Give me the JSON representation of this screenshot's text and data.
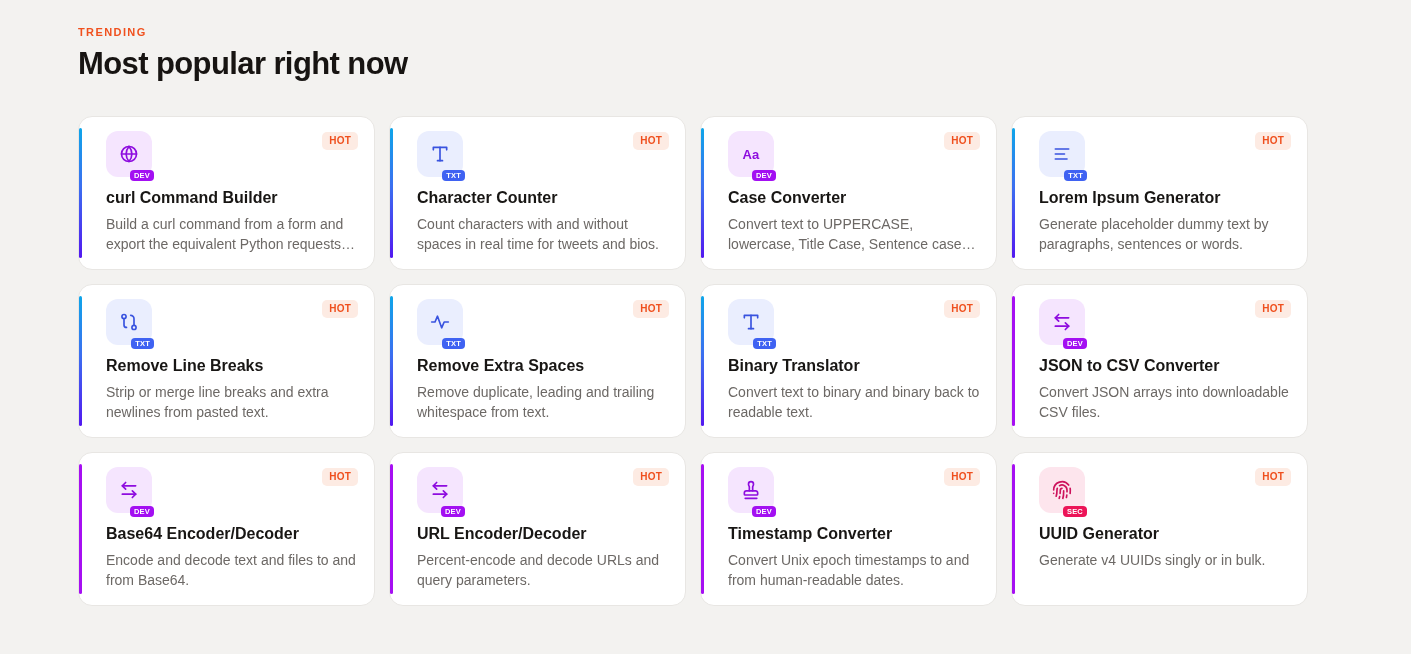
{
  "section": {
    "eyebrow": "TRENDING",
    "title": "Most popular right now"
  },
  "cards": [
    {
      "kind": "globe",
      "gradient_accent": true,
      "category": {
        "label": "DEV",
        "color": "#a30ff2"
      },
      "tag": "HOT",
      "title": "curl Command Builder",
      "description": "Build a curl command from a form and export the equivalent Python requests…"
    },
    {
      "kind": "type",
      "gradient_accent": true,
      "category": {
        "label": "TXT",
        "color": "#3f62f2"
      },
      "tag": "HOT",
      "title": "Character Counter",
      "description": "Count characters with and without spaces in real time for tweets and bios."
    },
    {
      "kind": "letters",
      "glyph": "Aa",
      "gradient_accent": true,
      "category": {
        "label": "DEV",
        "color": "#a30ff2"
      },
      "tag": "HOT",
      "title": "Case Converter",
      "description": "Convert text to UPPERCASE, lowercase, Title Case, Sentence case…"
    },
    {
      "kind": "lines",
      "gradient_accent": true,
      "category": {
        "label": "TXT",
        "color": "#3f62f2"
      },
      "tag": "HOT",
      "title": "Lorem Ipsum Generator",
      "description": "Generate placeholder dummy text by paragraphs, sentences or words."
    },
    {
      "kind": "route",
      "gradient_accent": true,
      "category": {
        "label": "TXT",
        "color": "#3f62f2"
      },
      "tag": "HOT",
      "title": "Remove Line Breaks",
      "description": "Strip or merge line breaks and extra newlines from pasted text."
    },
    {
      "kind": "pulse",
      "gradient_accent": true,
      "category": {
        "label": "TXT",
        "color": "#3f62f2"
      },
      "tag": "HOT",
      "title": "Remove Extra Spaces",
      "description": "Remove duplicate, leading and trailing whitespace from text."
    },
    {
      "kind": "type",
      "gradient_accent": true,
      "category": {
        "label": "TXT",
        "color": "#3f62f2"
      },
      "tag": "HOT",
      "title": "Binary Translator",
      "description": "Convert text to binary and binary back to readable text."
    },
    {
      "kind": "arrows",
      "gradient_accent": false,
      "category": {
        "label": "DEV",
        "color": "#a30ff2"
      },
      "tag": "HOT",
      "title": "JSON to CSV Converter",
      "description": "Convert JSON arrays into downloadable CSV files."
    },
    {
      "kind": "arrows",
      "gradient_accent": false,
      "category": {
        "label": "DEV",
        "color": "#a30ff2"
      },
      "tag": "HOT",
      "title": "Base64 Encoder/Decoder",
      "description": "Encode and decode text and files to and from Base64."
    },
    {
      "kind": "arrows",
      "gradient_accent": false,
      "category": {
        "label": "DEV",
        "color": "#a30ff2"
      },
      "tag": "HOT",
      "title": "URL Encoder/Decoder",
      "description": "Percent-encode and decode URLs and query parameters."
    },
    {
      "kind": "stamp",
      "gradient_accent": false,
      "category": {
        "label": "DEV",
        "color": "#a30ff2"
      },
      "tag": "HOT",
      "title": "Timestamp Converter",
      "description": "Convert Unix epoch timestamps to and from human-readable dates."
    },
    {
      "kind": "fingerprint",
      "gradient_accent": false,
      "category": {
        "label": "SEC",
        "color": "#ec1558"
      },
      "tag": "HOT",
      "title": "UUID Generator",
      "description": "Generate v4 UUIDs singly or in bulk."
    }
  ]
}
